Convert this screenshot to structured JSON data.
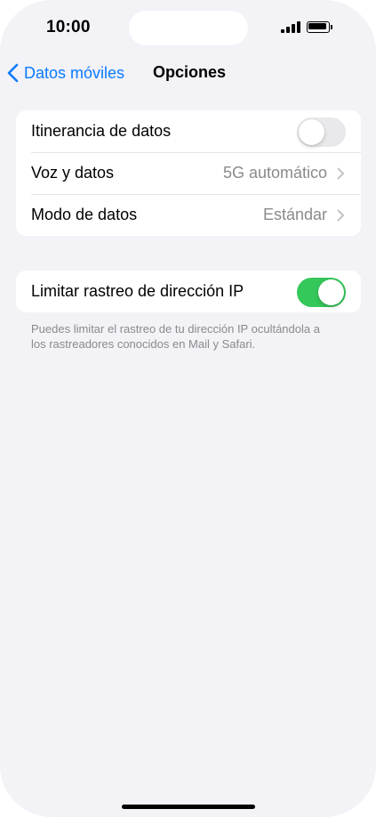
{
  "status_bar": {
    "time": "10:00",
    "icons": [
      "cellular-signal-icon",
      "battery-icon"
    ]
  },
  "nav": {
    "back_label": "Datos móviles",
    "back_icon": "chevron-left-icon",
    "title": "Opciones"
  },
  "group1": {
    "rows": [
      {
        "label": "Itinerancia de datos",
        "type": "toggle",
        "on": false
      },
      {
        "label": "Voz y datos",
        "type": "disclosure",
        "value": "5G automático"
      },
      {
        "label": "Modo de datos",
        "type": "disclosure",
        "value": "Estándar"
      }
    ]
  },
  "group2": {
    "rows": [
      {
        "label": "Limitar rastreo de dirección IP",
        "type": "toggle",
        "on": true
      }
    ],
    "footer": "Puedes limitar el rastreo de tu dirección IP ocultándola a los rastreadores conocidos en Mail y Safari."
  },
  "colors": {
    "accent": "#0a7aff",
    "toggle_on": "#34c759",
    "toggle_off": "#e9e9eb",
    "background": "#f2f2f7",
    "secondary_text": "#8a8a8e"
  }
}
